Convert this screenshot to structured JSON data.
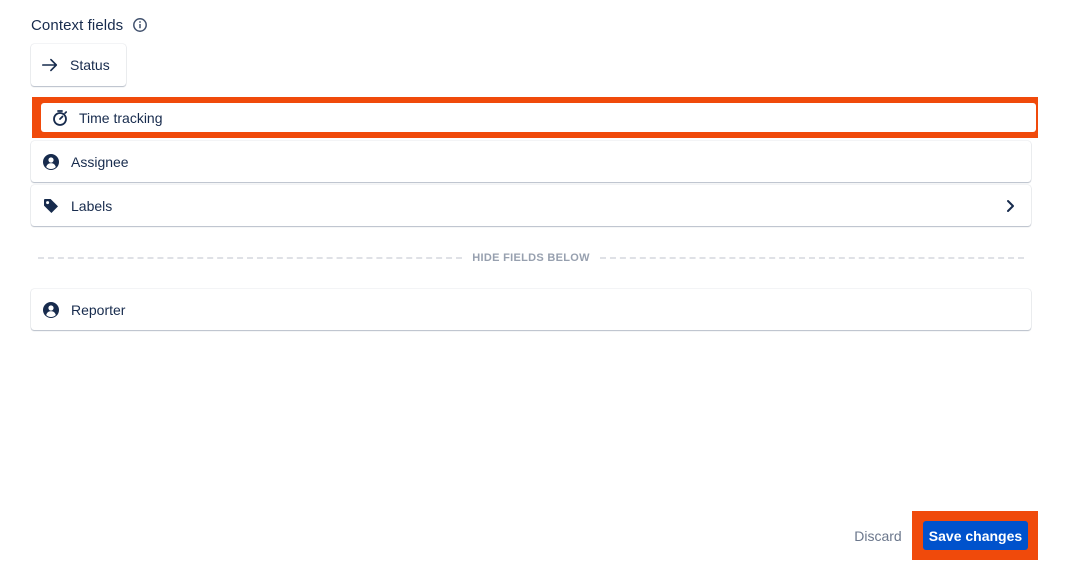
{
  "section": {
    "title": "Context fields",
    "info_icon": "info-icon"
  },
  "fields": {
    "status": {
      "label": "Status",
      "icon": "arrow-right-icon"
    },
    "time_tracking": {
      "label": "Time tracking",
      "icon": "stopwatch-icon"
    },
    "assignee": {
      "label": "Assignee",
      "icon": "user-avatar-icon"
    },
    "labels": {
      "label": "Labels",
      "icon": "tag-icon",
      "trailing_icon": "chevron-right-icon"
    },
    "reporter": {
      "label": "Reporter",
      "icon": "user-avatar-icon"
    }
  },
  "divider": {
    "label": "HIDE FIELDS BELOW"
  },
  "actions": {
    "discard_label": "Discard",
    "save_label": "Save changes"
  },
  "colors": {
    "text": "#172b4d",
    "primary": "#0052cc",
    "highlight": "#f04a0b",
    "muted": "#6b778c",
    "divider": "#dfe1e6"
  }
}
